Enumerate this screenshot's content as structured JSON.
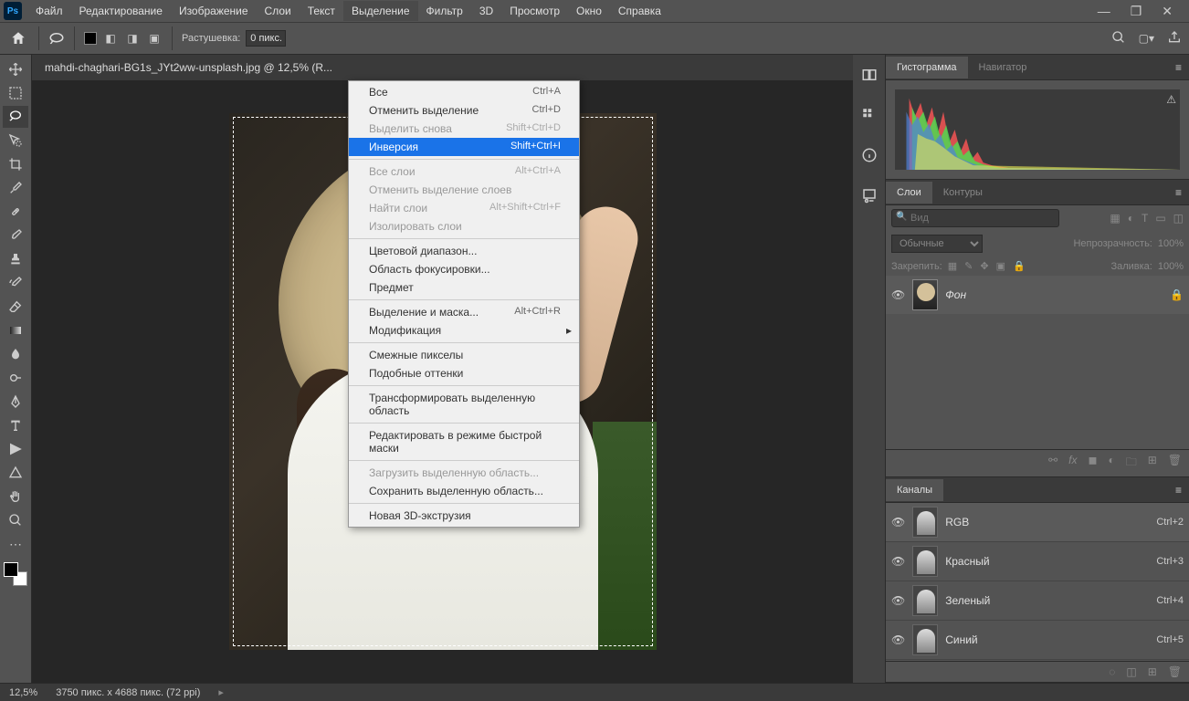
{
  "menubar": {
    "items": [
      "Файл",
      "Редактирование",
      "Изображение",
      "Слои",
      "Текст",
      "Выделение",
      "Фильтр",
      "3D",
      "Просмотр",
      "Окно",
      "Справка"
    ],
    "active_index": 5
  },
  "options": {
    "feather_label": "Растушевка:",
    "feather_value": "0 пикс."
  },
  "document": {
    "tab_title": "mahdi-chaghari-BG1s_JYt2ww-unsplash.jpg @ 12,5% (R..."
  },
  "dropdown": {
    "groups": [
      [
        {
          "label": "Все",
          "shortcut": "Ctrl+A",
          "disabled": false
        },
        {
          "label": "Отменить выделение",
          "shortcut": "Ctrl+D",
          "disabled": false
        },
        {
          "label": "Выделить снова",
          "shortcut": "Shift+Ctrl+D",
          "disabled": true
        },
        {
          "label": "Инверсия",
          "shortcut": "Shift+Ctrl+I",
          "disabled": false,
          "highlighted": true
        }
      ],
      [
        {
          "label": "Все слои",
          "shortcut": "Alt+Ctrl+A",
          "disabled": true
        },
        {
          "label": "Отменить выделение слоев",
          "shortcut": "",
          "disabled": true
        },
        {
          "label": "Найти слои",
          "shortcut": "Alt+Shift+Ctrl+F",
          "disabled": true
        },
        {
          "label": "Изолировать слои",
          "shortcut": "",
          "disabled": true
        }
      ],
      [
        {
          "label": "Цветовой диапазон...",
          "shortcut": "",
          "disabled": false
        },
        {
          "label": "Область фокусировки...",
          "shortcut": "",
          "disabled": false
        },
        {
          "label": "Предмет",
          "shortcut": "",
          "disabled": false
        }
      ],
      [
        {
          "label": "Выделение и маска...",
          "shortcut": "Alt+Ctrl+R",
          "disabled": false
        },
        {
          "label": "Модификация",
          "shortcut": "",
          "disabled": false,
          "submenu": true
        }
      ],
      [
        {
          "label": "Смежные пикселы",
          "shortcut": "",
          "disabled": false
        },
        {
          "label": "Подобные оттенки",
          "shortcut": "",
          "disabled": false
        }
      ],
      [
        {
          "label": "Трансформировать выделенную область",
          "shortcut": "",
          "disabled": false
        }
      ],
      [
        {
          "label": "Редактировать в режиме быстрой маски",
          "shortcut": "",
          "disabled": false
        }
      ],
      [
        {
          "label": "Загрузить выделенную область...",
          "shortcut": "",
          "disabled": true
        },
        {
          "label": "Сохранить выделенную область...",
          "shortcut": "",
          "disabled": false
        }
      ],
      [
        {
          "label": "Новая 3D-экструзия",
          "shortcut": "",
          "disabled": false
        }
      ]
    ]
  },
  "panels": {
    "histogram": {
      "tabs": [
        "Гистограмма",
        "Навигатор"
      ],
      "active": 0
    },
    "layers": {
      "tabs": [
        "Слои",
        "Контуры"
      ],
      "active": 0,
      "search_placeholder": "Вид",
      "blend_mode": "Обычные",
      "opacity_label": "Непрозрачность:",
      "opacity_value": "100%",
      "lock_label": "Закрепить:",
      "fill_label": "Заливка:",
      "fill_value": "100%",
      "items": [
        {
          "name": "Фон",
          "locked": true
        }
      ]
    },
    "channels": {
      "tab": "Каналы",
      "items": [
        {
          "name": "RGB",
          "shortcut": "Ctrl+2"
        },
        {
          "name": "Красный",
          "shortcut": "Ctrl+3"
        },
        {
          "name": "Зеленый",
          "shortcut": "Ctrl+4"
        },
        {
          "name": "Синий",
          "shortcut": "Ctrl+5"
        }
      ]
    }
  },
  "status": {
    "zoom": "12,5%",
    "dims": "3750 пикс. x 4688 пикс. (72 ppi)"
  }
}
